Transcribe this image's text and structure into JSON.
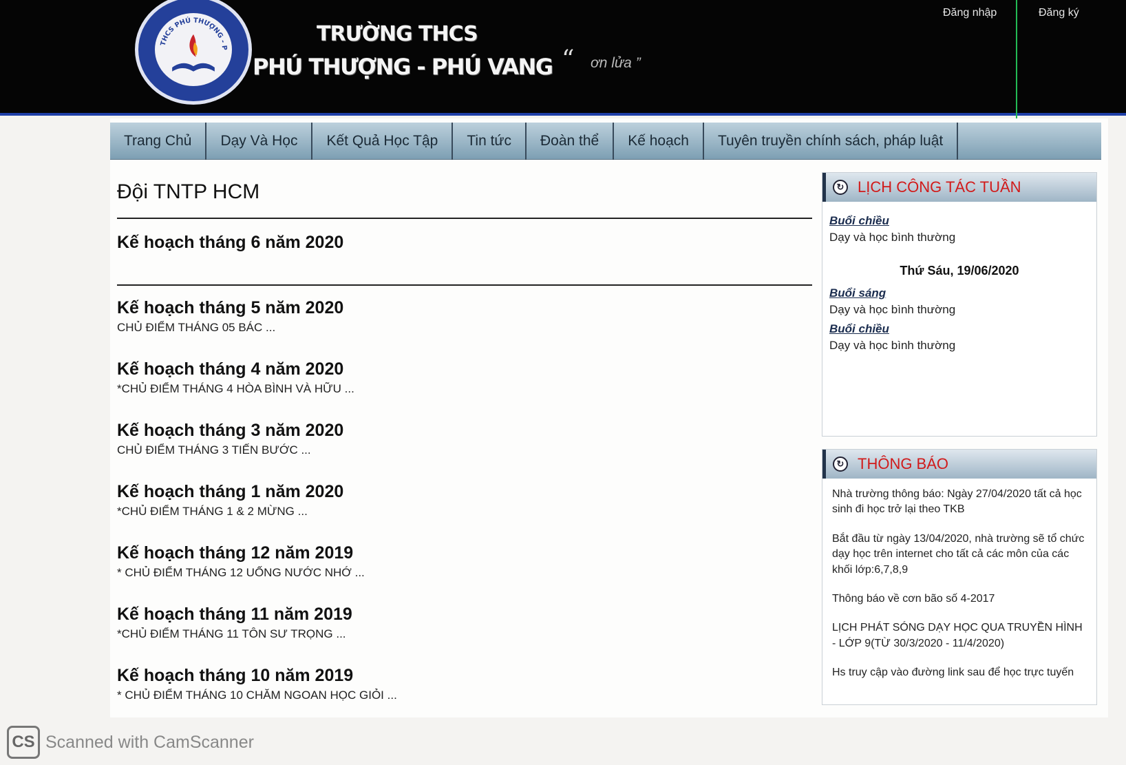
{
  "header": {
    "logo_text": "THCS PHÚ THƯỢNG - PHÚ VANG",
    "school_line1": "TRƯỜNG THCS",
    "school_line2": "PHÚ THƯỢNG - PHÚ VANG",
    "quote_open": "“",
    "quote_text": "ơn lửa ”",
    "login": "Đăng nhập",
    "register": "Đăng ký"
  },
  "nav": [
    "Trang Chủ",
    "Dạy Và Học",
    "Kết Quả Học Tập",
    "Tin tức",
    "Đoàn thể",
    "Kế hoạch",
    "Tuyên truyền chính sách, pháp luật"
  ],
  "main": {
    "page_title": "Đội TNTP HCM",
    "featured": "Kế hoạch tháng 6 năm 2020",
    "posts": [
      {
        "title": "Kế hoạch tháng 5 năm 2020",
        "excerpt": "CHỦ ĐIỂM THÁNG 05 BÁC ..."
      },
      {
        "title": "Kế hoạch tháng 4 năm 2020",
        "excerpt": "*CHỦ ĐIỂM THÁNG 4 HÒA BÌNH VÀ HỮU ..."
      },
      {
        "title": "Kế hoạch tháng 3 năm 2020",
        "excerpt": "CHỦ ĐIỂM THÁNG 3 TIẾN BƯỚC ..."
      },
      {
        "title": "Kế hoạch tháng 1 năm 2020",
        "excerpt": "*CHỦ ĐIỂM THÁNG 1 & 2 MỪNG ..."
      },
      {
        "title": "Kế hoạch tháng 12 năm 2019",
        "excerpt": "* CHỦ ĐIỂM THÁNG 12 UỐNG NƯỚC NHỚ ..."
      },
      {
        "title": "Kế hoạch tháng 11 năm 2019",
        "excerpt": "*CHỦ ĐIỂM THÁNG 11 TÔN SƯ TRỌNG ..."
      },
      {
        "title": "Kế hoạch tháng 10 năm 2019",
        "excerpt": "* CHỦ ĐIỂM THÁNG 10 CHĂM NGOAN HỌC GIỎI ..."
      }
    ]
  },
  "sidebar": {
    "schedule": {
      "title": "LỊCH CÔNG TÁC TUẦN",
      "afternoon": "Buổi chiều",
      "morning": "Buổi sáng",
      "normal": "Dạy và học bình thường",
      "date": "Thứ Sáu, 19/06/2020"
    },
    "notices": {
      "title": "THÔNG BÁO",
      "items": [
        "Nhà trường thông báo: Ngày 27/04/2020 tất cả học sinh đi học trở lại theo TKB",
        "Bắt đầu từ ngày 13/04/2020, nhà trường sẽ tổ chức dạy học trên internet cho tất cả các môn của các khối lớp:6,7,8,9",
        "Thông báo về cơn bão số 4-2017",
        "LỊCH PHÁT SÓNG DẠY HỌC QUA TRUYỀN HÌNH - LỚP 9(TỪ 30/3/2020 - 11/4/2020)",
        "Hs truy cập vào đường link sau để học trực tuyến"
      ]
    }
  },
  "footer": {
    "cs_logo": "CS",
    "scan_text": "Scanned with CamScanner"
  },
  "colors": {
    "header_bg": "#050505",
    "nav_gradient_top": "#bcd0dc",
    "nav_gradient_bottom": "#7d9fb3",
    "panel_title": "#d11a1a"
  }
}
